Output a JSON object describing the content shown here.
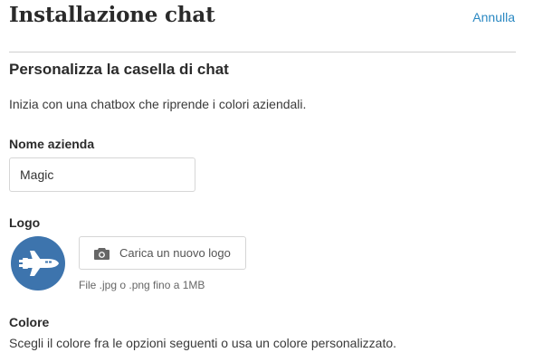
{
  "header": {
    "title": "Installazione chat",
    "cancel_label": "Annulla"
  },
  "section": {
    "title": "Personalizza la casella di chat",
    "description": "Inizia con una chatbox che riprende i colori aziendali."
  },
  "company_name": {
    "label": "Nome azienda",
    "value": "Magic"
  },
  "logo": {
    "label": "Logo",
    "icon": "space-shuttle-icon",
    "upload_icon": "camera-icon",
    "upload_label": "Carica un nuovo logo",
    "file_hint": "File .jpg o .png fino a 1MB"
  },
  "color": {
    "label": "Colore",
    "description": "Scegli il colore fra le opzioni seguenti o usa un colore personalizzato."
  },
  "colors": {
    "accent": "#2a88c2",
    "logo_background": "#3d74ad",
    "divider": "#cfcfcf"
  }
}
